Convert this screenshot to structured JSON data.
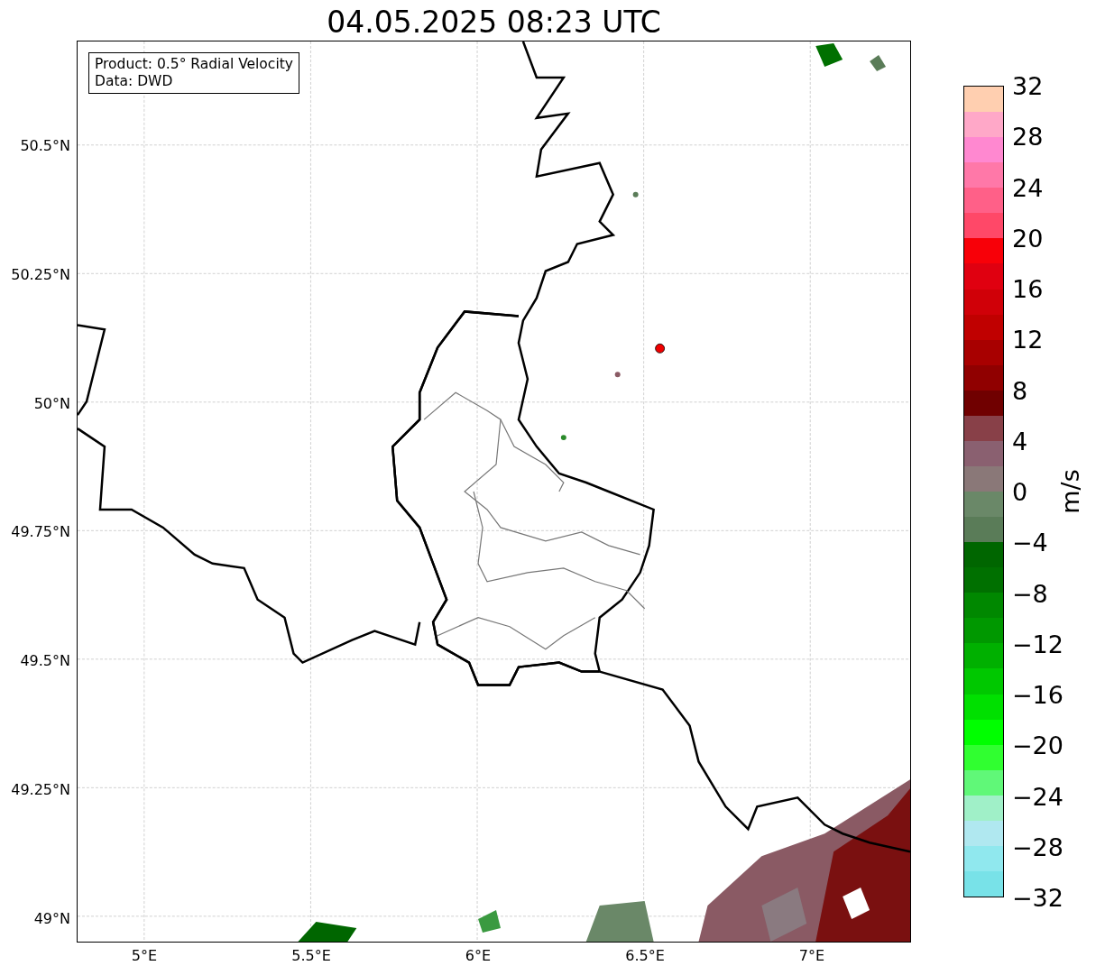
{
  "title": "04.05.2025 08:23 UTC",
  "legend": [
    "Product: 0.5° Radial Velocity",
    "Data: DWD"
  ],
  "lat_ticks": [
    "50.5°N",
    "50.25°N",
    "50°N",
    "49.75°N",
    "49.5°N",
    "49.25°N",
    "49°N"
  ],
  "lon_ticks": [
    "5°E",
    "5.5°E",
    "6°E",
    "6.5°E",
    "7°E"
  ],
  "colorbar": {
    "label": "m/s",
    "ticks": [
      "32",
      "28",
      "24",
      "20",
      "16",
      "12",
      "8",
      "4",
      "0",
      "−4",
      "−8",
      "−12",
      "−16",
      "−20",
      "−24",
      "−28",
      "−32"
    ],
    "bands": [
      {
        "color": "#ffcfb0"
      },
      {
        "color": "#ffa8c8"
      },
      {
        "color": "#ff88d0"
      },
      {
        "color": "#ff78a8"
      },
      {
        "color": "#ff6088"
      },
      {
        "color": "#ff4868"
      },
      {
        "color": "#f80008"
      },
      {
        "color": "#e00010"
      },
      {
        "color": "#d00008"
      },
      {
        "color": "#c00000"
      },
      {
        "color": "#a80000"
      },
      {
        "color": "#900000"
      },
      {
        "color": "#700000"
      },
      {
        "color": "#884048"
      },
      {
        "color": "#8a6070"
      },
      {
        "color": "#8a7878"
      },
      {
        "color": "#6a8868"
      },
      {
        "color": "#5a7c58"
      },
      {
        "color": "#006600"
      },
      {
        "color": "#007000"
      },
      {
        "color": "#008800"
      },
      {
        "color": "#009800"
      },
      {
        "color": "#00b000"
      },
      {
        "color": "#00c800"
      },
      {
        "color": "#00e000"
      },
      {
        "color": "#00ff00"
      },
      {
        "color": "#30ff30"
      },
      {
        "color": "#60f878"
      },
      {
        "color": "#a0f0c8"
      },
      {
        "color": "#b0e8f0"
      },
      {
        "color": "#90e8ee"
      },
      {
        "color": "#78e2e8"
      }
    ]
  }
}
